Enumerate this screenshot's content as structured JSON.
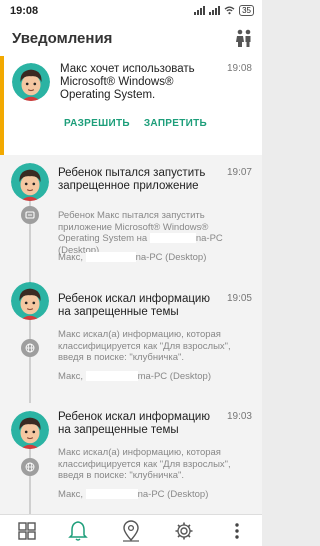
{
  "statusbar": {
    "time": "19:08",
    "battery": "35"
  },
  "header": {
    "title": "Уведомления"
  },
  "request": {
    "title": "Макс хочет использовать Microsoft® Windows® Operating System.",
    "time": "19:08",
    "allow_label": "РАЗРЕШИТЬ",
    "deny_label": "ЗАПРЕТИТЬ"
  },
  "events": [
    {
      "title": "Ребенок пытался запустить запрещенное приложение",
      "time": "19:07",
      "desc_a": "Ребенок Макс пытался запустить приложение Microsoft® Windows® Operating System на",
      "desc_b": "na-PC (Desktop).",
      "source_a": "Макс,",
      "source_b": "na-PC (Desktop)",
      "category_icon": "app-icon"
    },
    {
      "title": "Ребенок искал информацию на запрещенные темы",
      "time": "19:05",
      "desc": "Макс искал(а) информацию, которая классифицируется как \"Для взрослых\", введя в поиске: \"клубничка\".",
      "source_a": "Макс,",
      "source_b": "ma-PC (Desktop)",
      "category_icon": "globe-icon"
    },
    {
      "title": "Ребенок искал информацию на запрещенные темы",
      "time": "19:03",
      "desc": "Макс искал(а) информацию, которая классифицируется как \"Для взрослых\", введя в поиске: \"клубничка\".",
      "source_a": "Макс,",
      "source_b": "na-PC (Desktop)",
      "category_icon": "globe-icon"
    }
  ],
  "nav": {
    "items": [
      "dashboard-icon",
      "bell-icon",
      "location-icon",
      "settings-icon",
      "more-icon"
    ],
    "active": "bell-icon"
  },
  "colors": {
    "accent": "#1d9e7a",
    "highlight": "#f2a900",
    "teal_avatar_bg": "#2bb3a3"
  }
}
